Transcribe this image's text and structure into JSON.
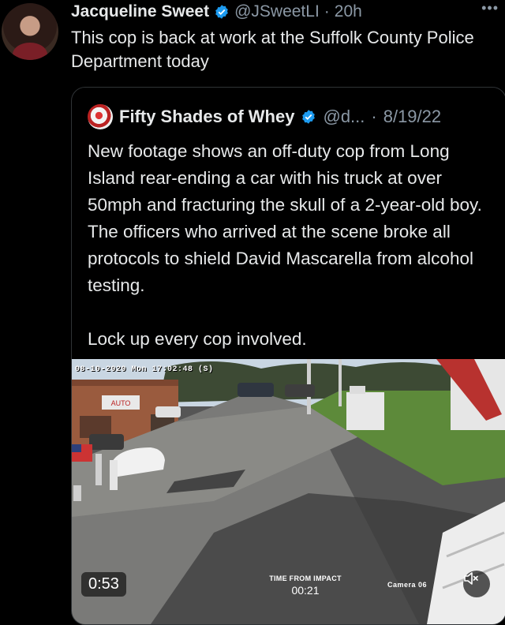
{
  "tweet": {
    "author_name": "Jacqueline Sweet",
    "handle": "@JSweetLI",
    "separator": "·",
    "time": "20h",
    "more": "•••",
    "text": "This cop is back at work at the Suffolk County Police Department today"
  },
  "quoted": {
    "author_name": "Fifty Shades of Whey",
    "handle": "@d...",
    "separator": "·",
    "date": "8/19/22",
    "text": "New footage shows an off-duty cop from Long Island rear-ending a car with his truck at over 50mph and fracturing the skull of a 2-year-old boy. The officers who arrived at the scene broke all protocols to shield David Mascarella from alcohol testing.\n\nLock up every cop involved."
  },
  "video": {
    "overlay_timestamp": "08-10-2020 Mon 17:02:48 (S)",
    "duration": "0:53",
    "impact_label": "TIME FROM IMPACT",
    "impact_value": "00:21",
    "camera_label": "Camera 06",
    "sign_text": "AUTO"
  },
  "colors": {
    "verified": "#1d9bf0",
    "muted_text": "#8b98a5",
    "border": "#2f3336"
  },
  "icons": [
    "verified-badge-icon",
    "mute-icon",
    "more-icon"
  ]
}
